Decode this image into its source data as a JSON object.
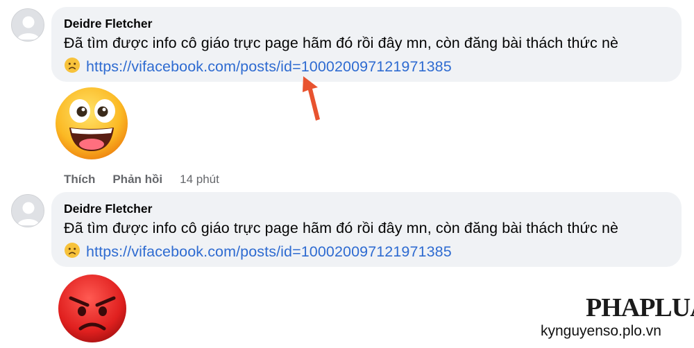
{
  "comments": [
    {
      "author": "Deidre Fletcher",
      "message": "Đã tìm được info cô giáo trực page hãm đó rồi đây mn, còn đăng bài thách thức nè",
      "link": "https://vifacebook.com/posts/id=100020097121971385",
      "emoji_icon": "frowning-face-emoji",
      "sticker_icon": "grinning-wide-eyes-sticker"
    },
    {
      "author": "Deidre Fletcher",
      "message": "Đã tìm được info cô giáo trực page hãm đó rồi đây mn, còn đăng bài thách thức nè",
      "link": "https://vifacebook.com/posts/id=100020097121971385",
      "emoji_icon": "frowning-face-emoji",
      "sticker_icon": "angry-face-sticker"
    }
  ],
  "actions": {
    "like_label": "Thích",
    "reply_label": "Phản hồi",
    "time": "14 phút"
  },
  "watermark": {
    "logo": "PHAPLUAT",
    "site": "kynguyenso.plo.vn"
  },
  "colors": {
    "bubble": "#f0f2f5",
    "link": "#2e6bd1",
    "action_text": "#65676b",
    "arrow": "#e8532f"
  }
}
